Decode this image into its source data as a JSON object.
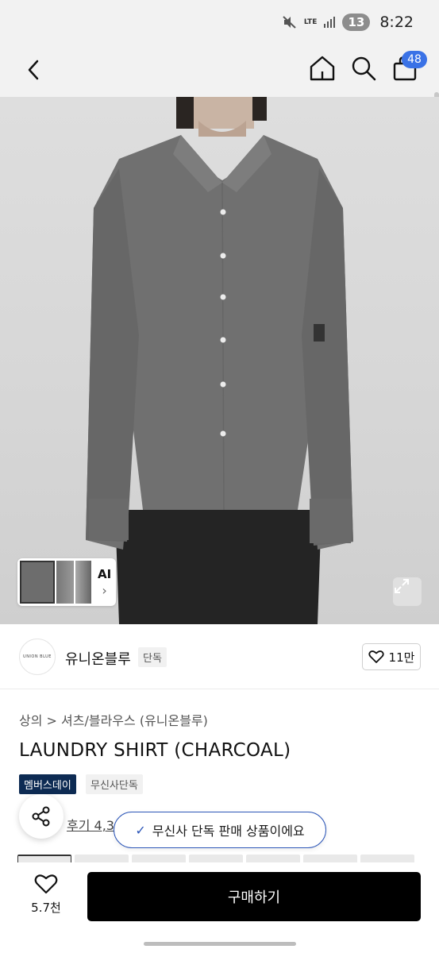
{
  "status_bar": {
    "network": "LTE",
    "notification_count": "13",
    "time": "8:22"
  },
  "nav": {
    "cart_count": "48"
  },
  "hero": {
    "thumbnail_ai_label": "AI"
  },
  "brand": {
    "logo_text": "UNION BLUE",
    "name": "유니온블루",
    "tag": "단독",
    "likes": "11만"
  },
  "product": {
    "breadcrumb": "상의 > 셔츠/블라우스 (유니온블루)",
    "title": "LAUNDRY SHIRT (CHARCOAL)",
    "tags": [
      "멤버스데이",
      "무신사단독"
    ],
    "reviews_partial": "후기 4,3"
  },
  "toast": {
    "message": "무신사 단독 판매 상품이에요"
  },
  "bottom_bar": {
    "wish_count": "5.7천",
    "buy_label": "구매하기"
  },
  "colors": {
    "buy_button": "#000000",
    "toast_border": "#2c56b8",
    "cart_badge": "#3a72e6",
    "member_tag": "#0d2b53"
  },
  "icons": [
    "back-icon",
    "home-icon",
    "search-icon",
    "cart-icon",
    "expand-icon",
    "heart-icon",
    "share-icon",
    "check-icon",
    "mute-icon",
    "signal-icon"
  ]
}
